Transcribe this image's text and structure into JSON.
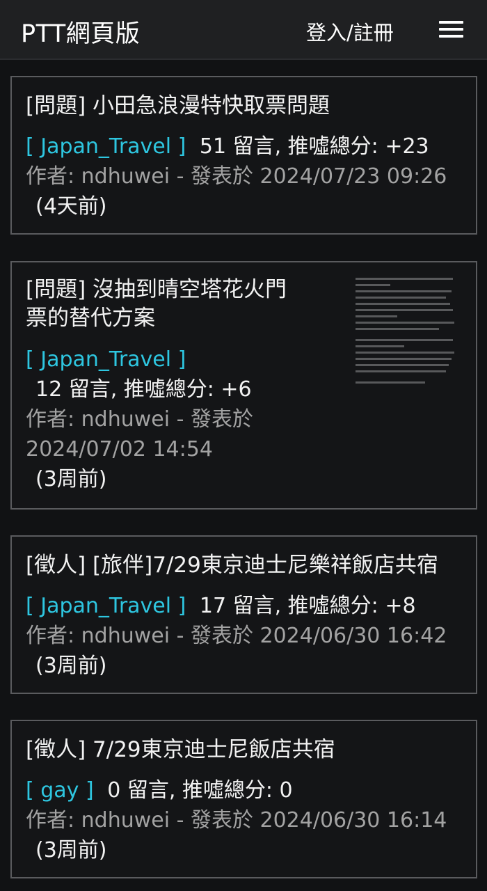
{
  "header": {
    "title": "PTT網頁版",
    "login_label": "登入/註冊",
    "menu_icon": "hamburger-menu-icon"
  },
  "posts": [
    {
      "title": "[問題] 小田急浪漫特快取票問題",
      "board": "[ Japan_Travel ]",
      "stats": "51 留言, 推噓總分: +23",
      "author": "作者: ndhuwei - 發表於 2024/07/23 09:26",
      "ago": "(4天前)"
    },
    {
      "title_line1": "[問題] 沒抽到晴空塔花火門",
      "title_line2": "票的替代方案",
      "board": "[ Japan_Travel ]",
      "stats": "12 留言, 推噓總分: +6",
      "author_line1": "作者: ndhuwei - 發表於",
      "author_line2": "2024/07/02 14:54",
      "ago": "(3周前)",
      "thumbnail": "article-thumbnail"
    },
    {
      "title": "[徵人] [旅伴]7/29東京迪士尼樂祥飯店共宿",
      "board": "[ Japan_Travel ]",
      "stats": "17 留言, 推噓總分: +8",
      "author": "作者: ndhuwei - 發表於 2024/06/30 16:42",
      "ago": "(3周前)"
    },
    {
      "title": "[徵人] 7/29東京迪士尼飯店共宿",
      "board": "[ gay ]",
      "stats": "0 留言, 推噓總分: 0",
      "author": "作者: ndhuwei - 發表於 2024/06/30 16:14",
      "ago": "(3周前)"
    }
  ],
  "colors": {
    "background": "#111214",
    "header": "#1f2022",
    "board_link": "#2ec6e0",
    "muted_text": "#a3a3a3",
    "card_border": "#5a5b5e"
  }
}
